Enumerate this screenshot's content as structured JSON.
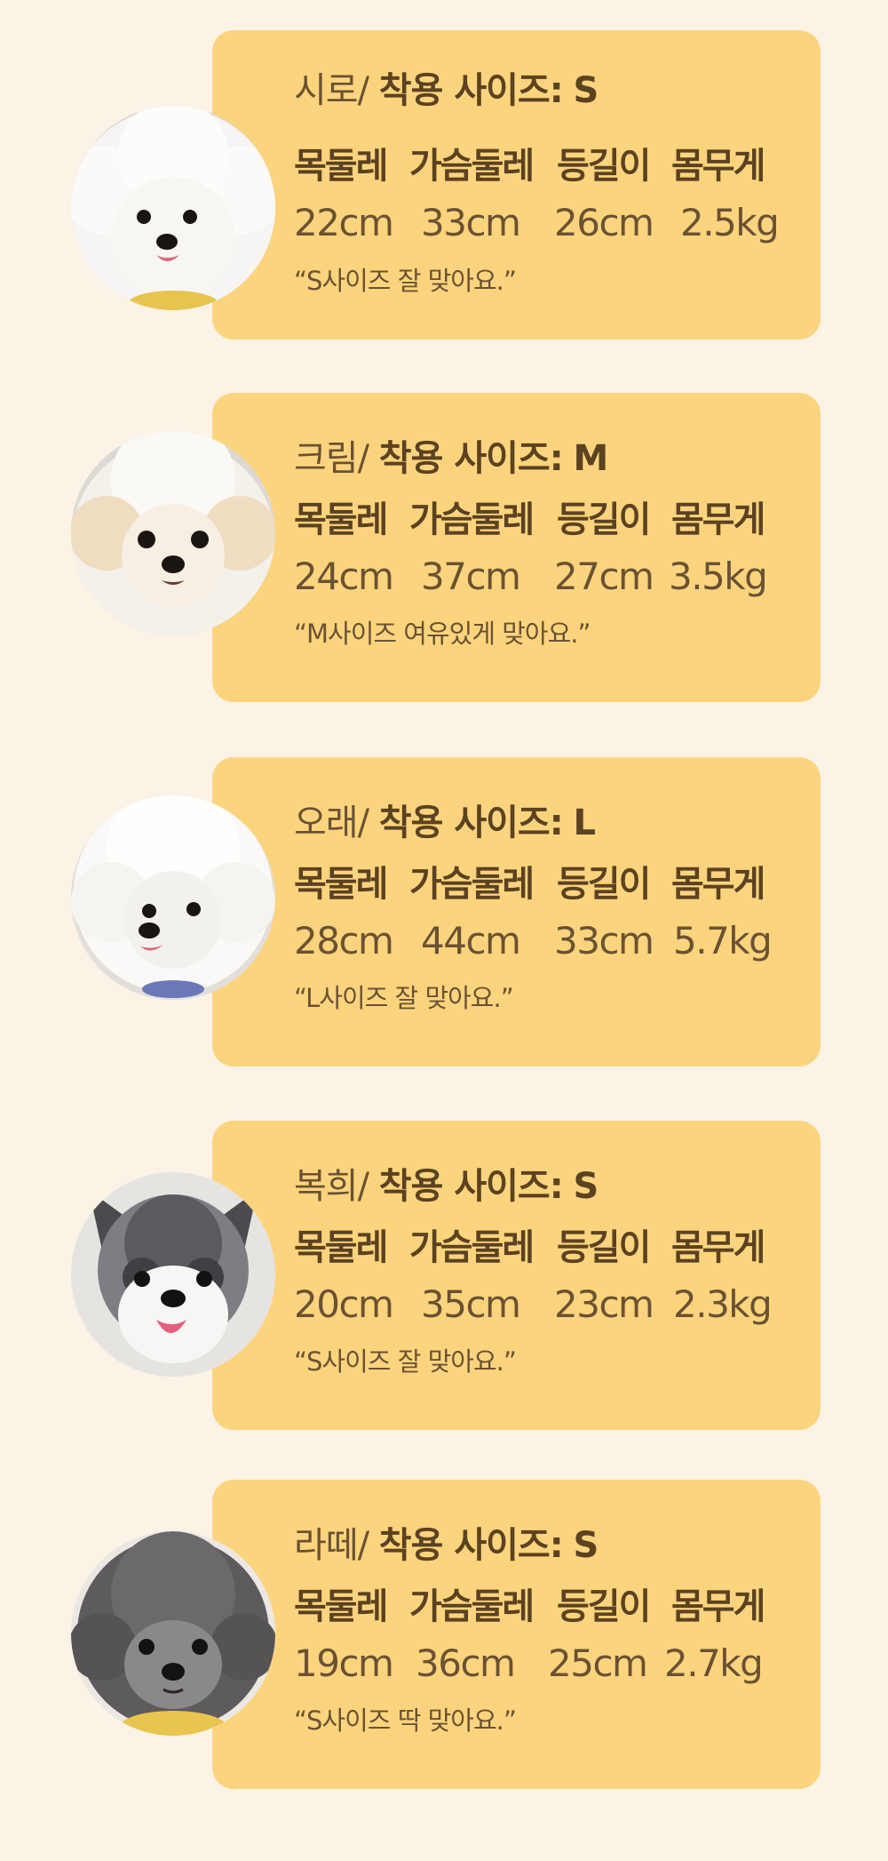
{
  "size_label": "착용 사이즈:",
  "column_labels": [
    "목둘레",
    "가슴둘레",
    "등길이",
    "몸무게"
  ],
  "reviews": [
    {
      "name": "시로/",
      "size": "S",
      "neck": "22cm",
      "chest": "33cm",
      "back": "26cm",
      "weight": "2.5kg",
      "comment": "“S사이즈 잘 맞아요.”"
    },
    {
      "name": "크림/",
      "size": "M",
      "neck": "24cm",
      "chest": "37cm",
      "back": "27cm",
      "weight": "3.5kg",
      "comment": "“M사이즈 여유있게 맞아요.”"
    },
    {
      "name": "오래/",
      "size": "L",
      "neck": "28cm",
      "chest": "44cm",
      "back": "33cm",
      "weight": "5.7kg",
      "comment": "“L사이즈 잘 맞아요.”"
    },
    {
      "name": "복희/",
      "size": "S",
      "neck": "20cm",
      "chest": "35cm",
      "back": "23cm",
      "weight": "2.3kg",
      "comment": "“S사이즈 잘 맞아요.”"
    },
    {
      "name": "라떼/",
      "size": "S",
      "neck": "19cm",
      "chest": "36cm",
      "back": "25cm",
      "weight": "2.7kg",
      "comment": "“S사이즈 딱 맞아요.”"
    }
  ],
  "colors": {
    "background": "#faf3e6",
    "card": "#fdd47e",
    "text": "#5b4220"
  }
}
